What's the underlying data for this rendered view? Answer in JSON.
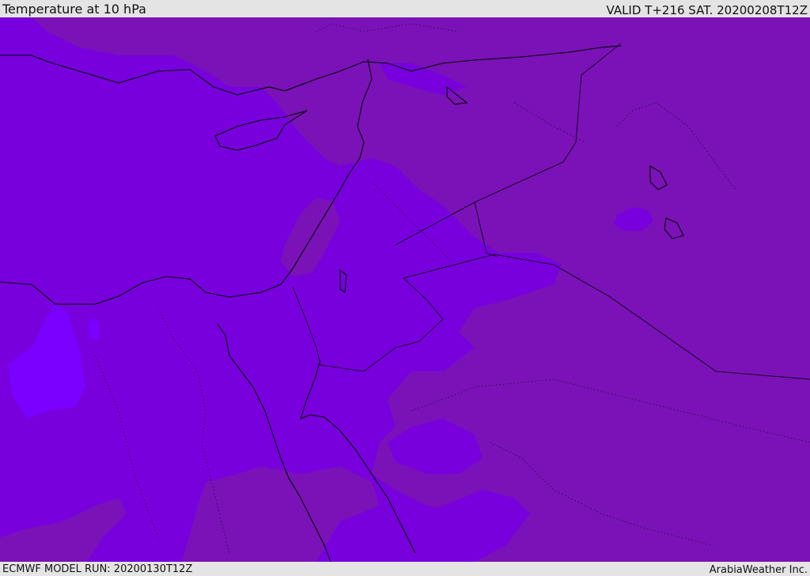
{
  "header": {
    "title": "Temperature at 10 hPa",
    "valid": "VALID T+216 SAT. 20200208T12Z"
  },
  "footer": {
    "model_run": "ECMWF MODEL RUN: 20200130T12Z",
    "credit": "ArabiaWeather Inc."
  },
  "map": {
    "colors": {
      "warm_band": "#7a12b8",
      "mid_band": "#7800dd",
      "cool_band": "#7a00ff",
      "darker_patch": "#6a109a",
      "coast": "#000000"
    }
  }
}
